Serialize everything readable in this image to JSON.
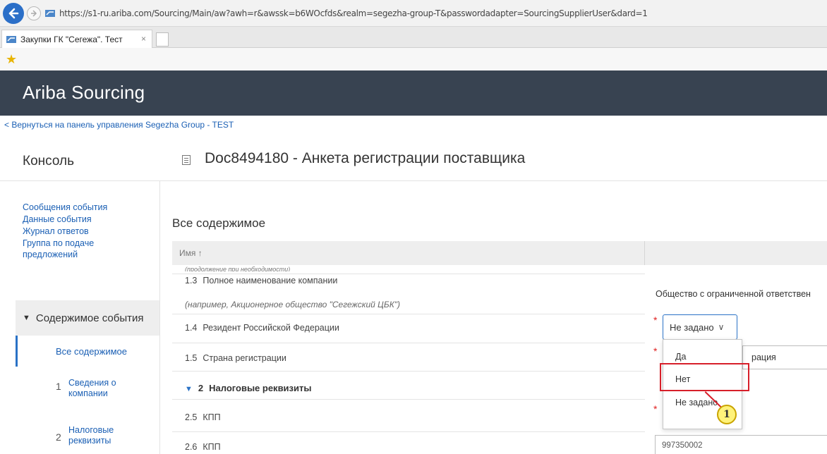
{
  "browser": {
    "url": "https://s1-ru.ariba.com/Sourcing/Main/aw?awh=r&awssk=b6WOcfds&realm=segezha-group-T&passwordadapter=SourcingSupplierUser&dard=1",
    "tab_title": "Закупки ГК \"Сегежа\". Тест",
    "tab_close": "×"
  },
  "app": {
    "title": "Ariba Sourcing",
    "back_link": "< Вернуться на панель управления Segezha Group - TEST"
  },
  "sidebar": {
    "title": "Консоль",
    "links": [
      "Сообщения события",
      "Данные события",
      "Журнал ответов",
      "Группа по подаче предложений"
    ],
    "section": "Содержимое события",
    "items": [
      {
        "num": "",
        "label": "Все содержимое"
      },
      {
        "num": "1",
        "label": "Сведения о компании"
      },
      {
        "num": "2",
        "label": "Налоговые реквизиты"
      }
    ]
  },
  "main": {
    "doc_title": "Doc8494180 - Анкета регистрации поставщика",
    "section_title": "Все содержимое",
    "table_header": "Имя ↑",
    "cut_row": "(продолжение при необходимости)",
    "rows": {
      "r13": {
        "num": "1.3",
        "label": "Полное наименование компании",
        "hint": "(например, Акционерное общество \"Сегежский ЦБК\")",
        "value": "Общество с ограниченной ответствен"
      },
      "r14": {
        "num": "1.4",
        "label": "Резидент Российской Федерации",
        "value": "Не задано"
      },
      "r15": {
        "num": "1.5",
        "label": "Страна регистрации",
        "value": "рация"
      },
      "s2": {
        "num": "2",
        "label": "Налоговые реквизиты"
      },
      "r25": {
        "num": "2.5",
        "label": "КПП"
      },
      "r26": {
        "num": "2.6",
        "label": "КПП",
        "value": "997350002"
      }
    },
    "dropdown_options": [
      "Да",
      "Нет",
      "Не задано"
    ],
    "callout": "1"
  },
  "colors": {
    "header_bg": "#384351",
    "link": "#1a5fb4",
    "highlight": "#d71f2a",
    "required": "#e02020"
  }
}
